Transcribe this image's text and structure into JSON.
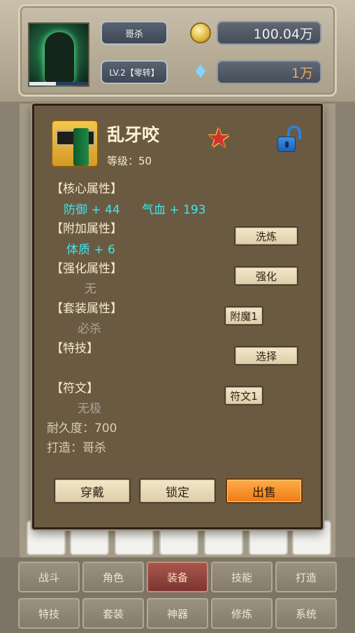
{
  "header": {
    "player_name": "哥杀",
    "player_level": "LV.2【零转】",
    "gold": "100.04万",
    "diamonds": "1万",
    "hp_fraction": 0.45
  },
  "dialog": {
    "item_name": "乱牙咬",
    "level_text": "等级：50",
    "core_heading": "【核心属性】",
    "core_attr_1": "防御 + 44",
    "core_attr_2": "气血 + 193",
    "extra_heading": "【附加属性】",
    "extra_attr_1": "体质 + 6",
    "enhance_heading": "【强化属性】",
    "enhance_value": "无",
    "set_heading": "【套装属性】",
    "set_value": "必杀",
    "skill_heading": "【特技】",
    "rune_heading": "【符文】",
    "rune_value": "无极",
    "durability": "耐久度：700",
    "crafter": "打造：哥杀",
    "btn_refine": "洗炼",
    "btn_enhance": "强化",
    "btn_enchant": "附魔1",
    "btn_select": "选择",
    "btn_rune": "符文1",
    "btn_wear": "穿戴",
    "btn_lock": "锁定",
    "btn_sell": "出售"
  },
  "nav": {
    "row1": [
      "战斗",
      "角色",
      "装备",
      "技能",
      "打造"
    ],
    "row2": [
      "特技",
      "套装",
      "神器",
      "修炼",
      "系统"
    ],
    "active": "装备"
  }
}
